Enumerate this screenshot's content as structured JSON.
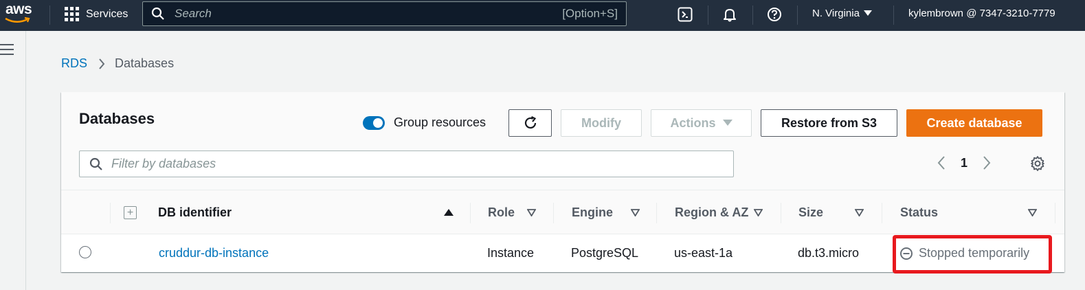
{
  "topbar": {
    "logo_text": "aws",
    "services_label": "Services",
    "search_placeholder": "Search",
    "search_shortcut": "[Option+S]",
    "region_label": "N. Virginia",
    "account_label": "kylembrown @ 7347-3210-7779"
  },
  "breadcrumb": {
    "root": "RDS",
    "current": "Databases"
  },
  "panel": {
    "title": "Databases",
    "group_toggle_label": "Group resources",
    "group_toggle_on": true,
    "modify_label": "Modify",
    "actions_label": "Actions",
    "restore_label": "Restore from S3",
    "create_label": "Create database",
    "filter_placeholder": "Filter by databases",
    "page_number": "1"
  },
  "table": {
    "columns": {
      "identifier": "DB identifier",
      "role": "Role",
      "engine": "Engine",
      "region": "Region & AZ",
      "size": "Size",
      "status": "Status"
    },
    "rows": [
      {
        "identifier": "cruddur-db-instance",
        "role": "Instance",
        "engine": "PostgreSQL",
        "region": "us-east-1a",
        "size": "db.t3.micro",
        "status": "Stopped temporarily"
      }
    ]
  },
  "colors": {
    "topbar_bg": "#232f3e",
    "link": "#0073bb",
    "primary_button": "#ec7211",
    "highlight_box": "#e8191e"
  },
  "icons": [
    "grid-icon",
    "search-icon",
    "cloudshell-icon",
    "bell-icon",
    "help-icon",
    "caret-down-icon",
    "menu-icon",
    "chevron-right-icon",
    "refresh-icon",
    "filter-search-icon",
    "chevron-left-icon",
    "settings-gear-icon",
    "expand-all-icon",
    "sort-ascending-icon",
    "sort-icon",
    "stopped-status-icon"
  ]
}
